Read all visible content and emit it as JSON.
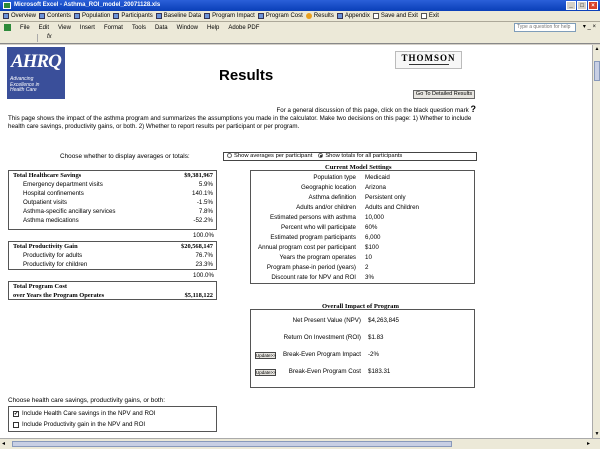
{
  "window": {
    "title": "Microsoft Excel - Asthma_ROI_model_20071128.xls",
    "min": "_",
    "max": "□",
    "close": "×"
  },
  "sheet_tabs": [
    {
      "label": "Overview",
      "icon": "sheet-icon"
    },
    {
      "label": "Contents",
      "icon": "sheet-icon"
    },
    {
      "label": "Population",
      "icon": "sheet-icon"
    },
    {
      "label": "Participants",
      "icon": "sheet-icon"
    },
    {
      "label": "Baseline Data",
      "icon": "sheet-icon"
    },
    {
      "label": "Program Impact",
      "icon": "sheet-icon"
    },
    {
      "label": "Program Cost",
      "icon": "sheet-icon"
    },
    {
      "label": "Results",
      "icon": "star-icon"
    },
    {
      "label": "Appendix",
      "icon": "sheet-icon"
    },
    {
      "label": "Save and Exit",
      "icon": "checkbox-icon"
    },
    {
      "label": "Exit",
      "icon": "checkbox-icon"
    }
  ],
  "menu": [
    "File",
    "Edit",
    "View",
    "Insert",
    "Format",
    "Tools",
    "Data",
    "Window",
    "Help",
    "Adobe PDF"
  ],
  "help_placeholder": "Type a question for help",
  "formula": {
    "cell": "",
    "fx": "fx"
  },
  "logo": {
    "name": "AHRQ",
    "tagline": [
      "Advancing",
      "Excellence in",
      "Health Care"
    ]
  },
  "brand": "THOMSON",
  "page_title": "Results",
  "goto_button": "Go To Detailed Results",
  "intro": {
    "line1": "For a general discussion of this page, click on the black question mark",
    "q": "?",
    "body": "This page shows the impact of the asthma program and summarizes the assumptions you made in the calculator. Make two decisions on this page: 1) Whether to include health care savings, productivity gains, or both. 2) Whether to report results per participant or per program."
  },
  "display_choice": {
    "label": "Choose whether to display averages or totals:",
    "opt_avg": "Show averages per participant",
    "opt_tot": "Show totals for all participants",
    "selected": "totals"
  },
  "healthcare": {
    "title": "Total Healthcare Savings",
    "total": "$9,381,967",
    "items": [
      {
        "label": "Emergency department visits",
        "value": "5.9%"
      },
      {
        "label": "Hospital confinements",
        "value": "140.1%"
      },
      {
        "label": "Outpatient visits",
        "value": "-1.5%"
      },
      {
        "label": "Asthma-specific ancillary services",
        "value": "7.8%"
      },
      {
        "label": "Asthma medications",
        "value": "-52.2%"
      }
    ],
    "subtotal": "100.0%"
  },
  "productivity": {
    "title": "Total Productivity Gain",
    "total": "$20,568,147",
    "items": [
      {
        "label": "Productivity for adults",
        "value": "76.7%"
      },
      {
        "label": "Productivity for children",
        "value": "23.3%"
      }
    ],
    "subtotal": "100.0%"
  },
  "program_cost": {
    "title1": "Total Program Cost",
    "title2": "over Years the Program Operates",
    "total": "$5,118,122"
  },
  "settings": {
    "title": "Current Model Settings",
    "rows": [
      {
        "k": "Population type",
        "v": "Medicaid"
      },
      {
        "k": "Geographic location",
        "v": "Arizona"
      },
      {
        "k": "Asthma definition",
        "v": "Persistent only"
      },
      {
        "k": "Adults and/or children",
        "v": "Adults and Children"
      },
      {
        "k": "Estimated persons with asthma",
        "v": "10,000"
      },
      {
        "k": "Percent who will participate",
        "v": "60%"
      },
      {
        "k": "Estimated program participants",
        "v": "6,000"
      },
      {
        "k": "Annual program cost per participant",
        "v": "$100"
      },
      {
        "k": "Years the program operates",
        "v": "10"
      },
      {
        "k": "Program phase-in period (years)",
        "v": "2"
      },
      {
        "k": "Discount rate for NPV and ROI",
        "v": "3%"
      }
    ]
  },
  "impact": {
    "title": "Overall Impact of Program",
    "rows": [
      {
        "k": "Net Present Value (NPV)",
        "v": "$4,263,845",
        "button": ""
      },
      {
        "k": "Return On Investment (ROI)",
        "v": "$1.83",
        "button": ""
      },
      {
        "k": "Break-Even Program Impact",
        "v": "-2%",
        "button": "Update>>"
      },
      {
        "k": "Break-Even Program Cost",
        "v": "$183.31",
        "button": "Update>>"
      }
    ]
  },
  "include": {
    "label": "Choose health care savings, productivity gains, or both:",
    "opt1": "Include Health Care savings in the NPV and ROI",
    "opt1_checked": true,
    "opt2": "Include Productivity gain in the NPV and ROI",
    "opt2_checked": false
  }
}
